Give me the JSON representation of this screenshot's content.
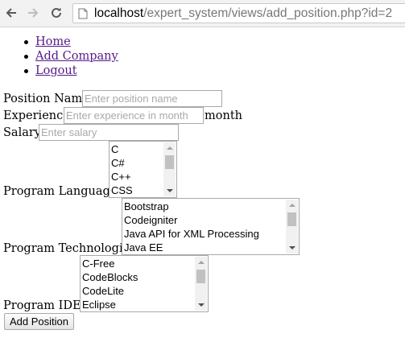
{
  "browser": {
    "url_host": "localhost",
    "url_path": "/expert_system/views/add_position.php?id=2"
  },
  "nav": {
    "items": [
      {
        "label": "Home"
      },
      {
        "label": "Add Company"
      },
      {
        "label": "Logout"
      }
    ]
  },
  "form": {
    "position_name": {
      "label": "Position Name",
      "placeholder": "Enter position name"
    },
    "experience": {
      "label": "Experience",
      "placeholder": "Enter experience in month",
      "suffix": "month"
    },
    "salary": {
      "label": "Salary",
      "placeholder": "Enter salary"
    },
    "languages": {
      "label": "Program Languages",
      "options": [
        "C",
        "C#",
        "C++",
        "CSS"
      ]
    },
    "technologies": {
      "label": "Program Technologies",
      "options": [
        "Bootstrap",
        "Codeigniter",
        "Java API for XML Processing",
        "Java EE"
      ]
    },
    "ides": {
      "label": "Program IDEs",
      "options": [
        "C-Free",
        "CodeBlocks",
        "CodeLite",
        "Eclipse"
      ]
    },
    "submit_label": "Add Position"
  }
}
